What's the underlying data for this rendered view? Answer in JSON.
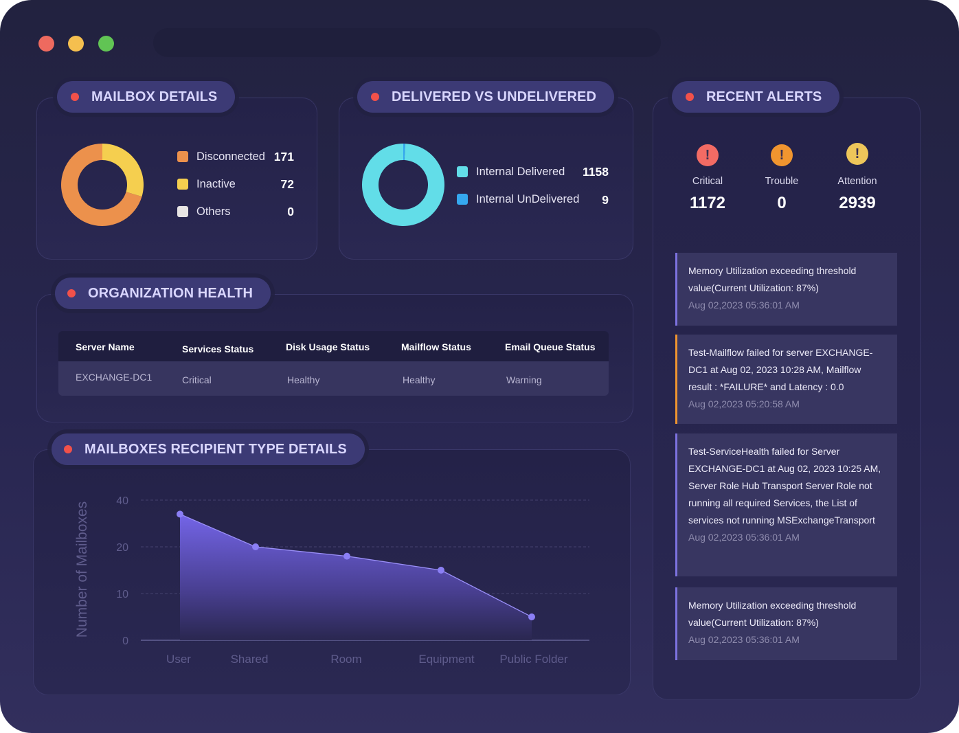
{
  "window": {
    "traffic_lights": [
      "close",
      "minimize",
      "maximize"
    ],
    "address_bar": ""
  },
  "mailbox_details": {
    "title": "MAILBOX DETAILS",
    "items": [
      {
        "label": "Disconnected",
        "value": "171",
        "color": "#ec914c"
      },
      {
        "label": "Inactive",
        "value": "72",
        "color": "#f5cf4f"
      },
      {
        "label": "Others",
        "value": "0",
        "color": "#e8e5e4"
      }
    ]
  },
  "delivered": {
    "title": "DELIVERED VS UNDELIVERED",
    "items": [
      {
        "label": "Internal Delivered",
        "value": "1158",
        "color": "#62dde8"
      },
      {
        "label": "Internal UnDelivered",
        "value": "9",
        "color": "#35a8ef"
      }
    ]
  },
  "org_health": {
    "title": "ORGANIZATION HEALTH",
    "columns": [
      "Server Name",
      "Services Status",
      "Disk Usage Status",
      "Mailflow Status",
      "Email Queue Status"
    ],
    "rows": [
      [
        "EXCHANGE-DC1",
        "Critical",
        "Healthy",
        "Healthy",
        "Warning"
      ]
    ]
  },
  "recent_alerts": {
    "title": "RECENT ALERTS",
    "stats": [
      {
        "label": "Critical",
        "count": "1172",
        "icon": "exclamation-icon",
        "color": "#f26b64"
      },
      {
        "label": "Trouble",
        "count": "0",
        "icon": "exclamation-icon",
        "color": "#f0952f"
      },
      {
        "label": "Attention",
        "count": "2939",
        "icon": "exclamation-icon",
        "color": "#eec65a"
      }
    ],
    "alerts": [
      {
        "message": "Memory Utilization exceeding threshold value(Current Utilization: 87%)",
        "time": "Aug 02,2023 05:36:01 AM",
        "severity_color": "#7d72e0"
      },
      {
        "message": "Test-Mailflow failed for server EXCHANGE-DC1 at Aug 02, 2023 10:28 AM, Mailflow result : *FAILURE* and Latency : 0.0",
        "time": "Aug 02,2023 05:20:58 AM",
        "severity_color": "#f0952f"
      },
      {
        "message": "Test-ServiceHealth failed for Server EXCHANGE-DC1 at Aug 02, 2023 10:25 AM, Server Role Hub Transport Server Role not running all required Services, the List of services not running MSExchangeTransport",
        "time": "Aug 02,2023 05:36:01 AM",
        "severity_color": "#7d72e0"
      },
      {
        "message": "Memory Utilization exceeding threshold value(Current Utilization: 87%)",
        "time": "Aug 02,2023 05:36:01 AM",
        "severity_color": "#7d72e0"
      }
    ]
  },
  "recipient_chart": {
    "title": "MAILBOXES RECIPIENT TYPE DETAILS"
  },
  "chart_data": [
    {
      "type": "pie",
      "title": "MAILBOX DETAILS",
      "categories": [
        "Disconnected",
        "Inactive",
        "Others"
      ],
      "values": [
        171,
        72,
        0
      ],
      "colors": [
        "#ec914c",
        "#f5cf4f",
        "#e8e5e4"
      ],
      "donut": true,
      "legend": "right"
    },
    {
      "type": "pie",
      "title": "DELIVERED VS UNDELIVERED",
      "categories": [
        "Internal Delivered",
        "Internal UnDelivered"
      ],
      "values": [
        1158,
        9
      ],
      "colors": [
        "#62dde8",
        "#35a8ef"
      ],
      "donut": true,
      "legend": "right"
    },
    {
      "type": "area",
      "title": "MAILBOXES RECIPIENT TYPE DETAILS",
      "categories": [
        "User",
        "Shared",
        "Room",
        "Equipment",
        "Public Folder"
      ],
      "values": [
        34,
        20,
        18,
        15,
        5
      ],
      "xlabel": "",
      "ylabel": "Number of Mailboxes",
      "yticks": [
        0,
        10,
        20,
        40
      ],
      "ylim": [
        0,
        40
      ],
      "grid": true,
      "color": "#8b7ff5"
    }
  ]
}
